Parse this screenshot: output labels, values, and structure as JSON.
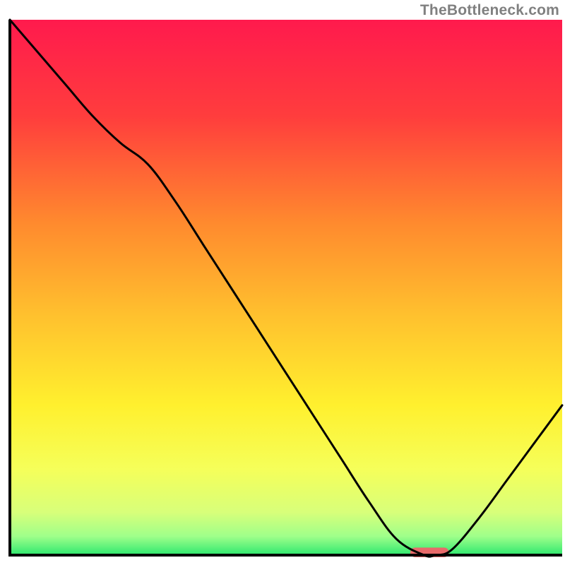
{
  "watermark": "TheBottleneck.com",
  "chart_data": {
    "type": "line",
    "title": "",
    "xlabel": "",
    "ylabel": "",
    "xlim": [
      0,
      100
    ],
    "ylim": [
      0,
      100
    ],
    "x": [
      0,
      5,
      10,
      15,
      20,
      25,
      30,
      35,
      40,
      45,
      50,
      55,
      60,
      65,
      70,
      75,
      77,
      80,
      85,
      90,
      95,
      100
    ],
    "values": [
      100,
      94,
      88,
      82,
      77,
      73,
      66,
      58,
      50,
      42,
      34,
      26,
      18,
      10,
      3,
      0,
      0,
      1,
      7,
      14,
      21,
      28
    ],
    "gradient_stops": [
      {
        "offset": 0.0,
        "color": "#ff1a4d"
      },
      {
        "offset": 0.18,
        "color": "#ff3d3d"
      },
      {
        "offset": 0.38,
        "color": "#ff8a2e"
      },
      {
        "offset": 0.55,
        "color": "#ffc02e"
      },
      {
        "offset": 0.72,
        "color": "#fff02e"
      },
      {
        "offset": 0.84,
        "color": "#f5ff5a"
      },
      {
        "offset": 0.92,
        "color": "#d8ff7a"
      },
      {
        "offset": 0.965,
        "color": "#9fff8a"
      },
      {
        "offset": 1.0,
        "color": "#2ee86f"
      }
    ],
    "marker": {
      "x": 76,
      "y": 0.5,
      "width": 7,
      "height": 1.8,
      "color": "#e86a6a"
    },
    "axis_color": "#000000",
    "curve_color": "#000000"
  }
}
